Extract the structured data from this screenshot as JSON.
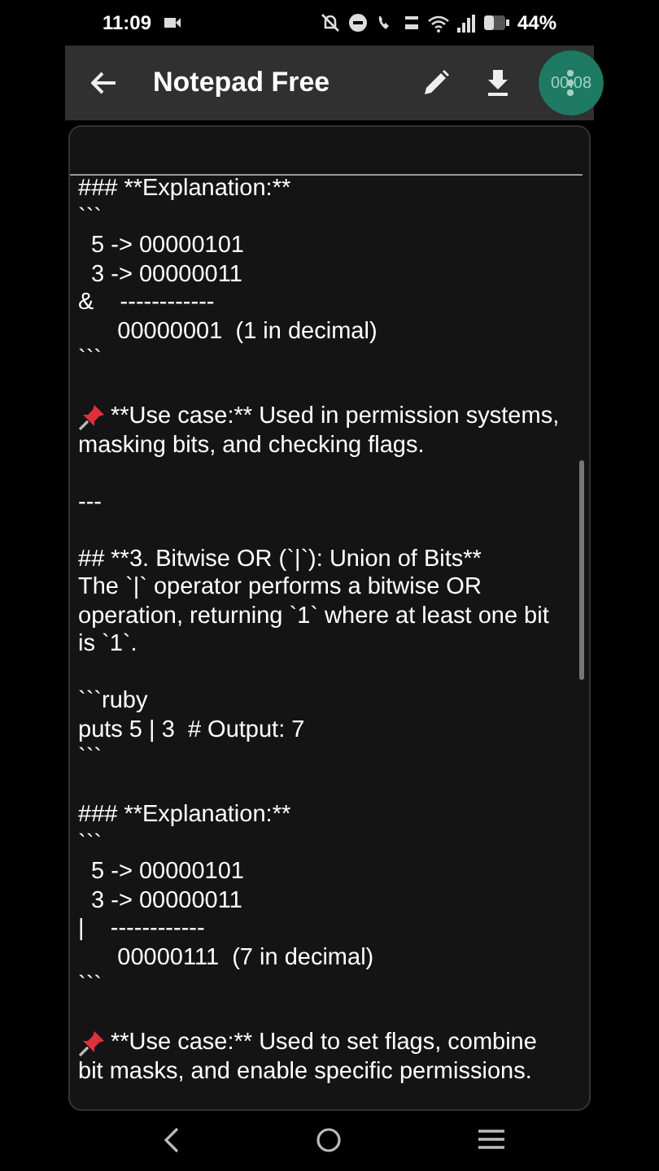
{
  "status_bar": {
    "time": "11:09",
    "battery": "44%"
  },
  "app_bar": {
    "title": "Notepad Free"
  },
  "recorder": {
    "time": "00:08"
  },
  "note": {
    "blocks": [
      {
        "kind": "text",
        "lines": [
          "### **Explanation:**",
          "```",
          "  5 -> 00000101",
          "  3 -> 00000011",
          "&    ------------",
          "      00000001  (1 in decimal)",
          "```"
        ]
      },
      {
        "kind": "pin",
        "lines": [
          "**Use case:** Used in permission systems,",
          "masking bits, and checking flags."
        ]
      },
      {
        "kind": "text",
        "lines": [
          "---"
        ]
      },
      {
        "kind": "text",
        "lines": [
          "## **3. Bitwise OR (`|`): Union of Bits**",
          "The `|` operator performs a bitwise OR",
          "operation, returning `1` where at least one bit",
          "is `1`."
        ]
      },
      {
        "kind": "text",
        "lines": [
          "```ruby",
          "puts 5 | 3  # Output: 7",
          "```"
        ]
      },
      {
        "kind": "text",
        "lines": [
          "### **Explanation:**",
          "```",
          "  5 -> 00000101",
          "  3 -> 00000011",
          "|    ------------",
          "      00000111  (7 in decimal)",
          "```"
        ]
      },
      {
        "kind": "pin",
        "lines": [
          "**Use case:** Used to set flags, combine",
          "bit masks, and enable specific permissions."
        ]
      }
    ]
  }
}
